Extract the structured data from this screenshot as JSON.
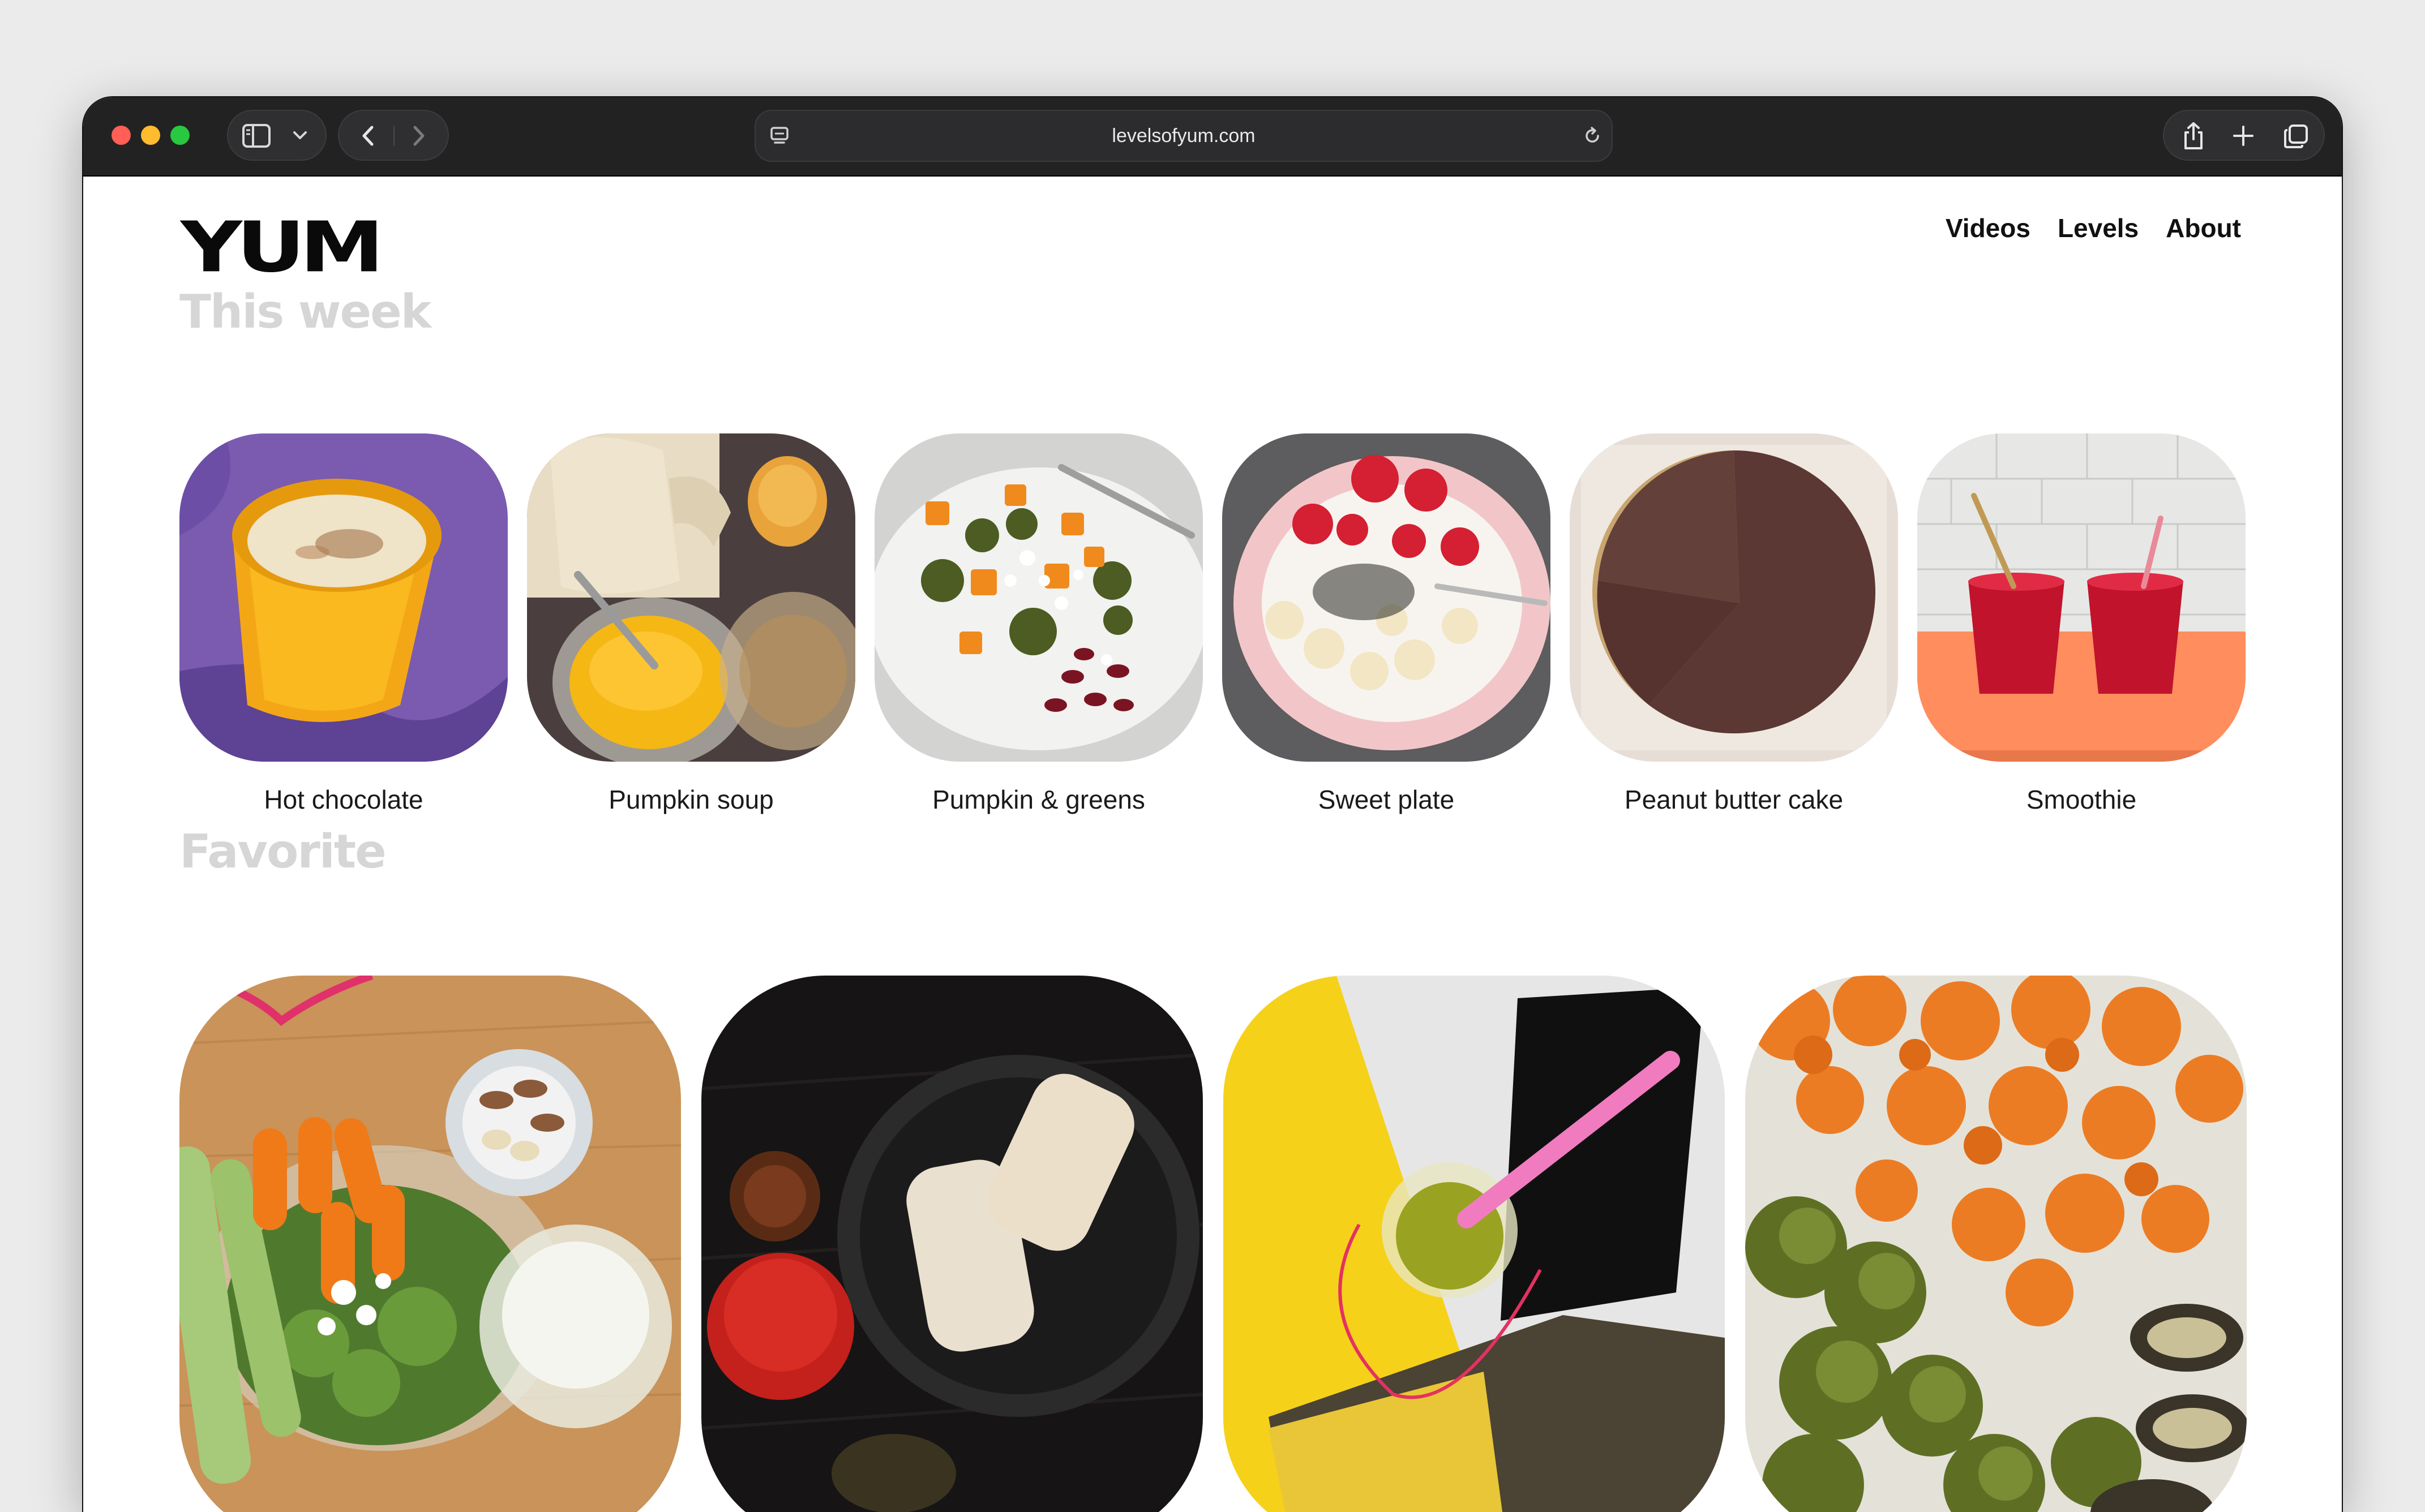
{
  "browser": {
    "url": "levelsofyum.com",
    "traffic_lights": [
      "#ff5f57",
      "#febc2e",
      "#28c840"
    ],
    "icons": [
      "sidebar-icon",
      "chevron-down-icon",
      "back-icon",
      "forward-icon",
      "page-settings-icon",
      "reload-icon",
      "share-icon",
      "new-tab-icon",
      "tab-overview-icon"
    ]
  },
  "site": {
    "logo": "YUM",
    "nav": [
      "Videos",
      "Levels",
      "About"
    ]
  },
  "sections": {
    "this_week": {
      "title": "This week",
      "items": [
        {
          "label": "Hot chocolate"
        },
        {
          "label": "Pumpkin soup"
        },
        {
          "label": "Pumpkin & greens"
        },
        {
          "label": "Sweet plate"
        },
        {
          "label": "Peanut butter cake"
        },
        {
          "label": "Smoothie"
        }
      ]
    },
    "favorite": {
      "title": "Favorite"
    }
  }
}
